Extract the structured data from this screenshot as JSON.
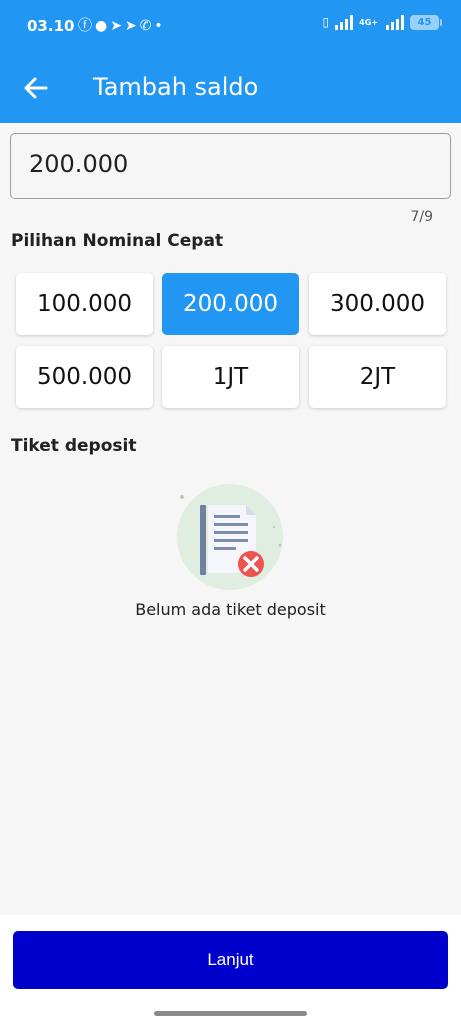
{
  "status_bar": {
    "time": "03.10",
    "notification_icons": [
      "facebook-icon",
      "chat-bubble-icon",
      "telegram-icon",
      "telegram-icon",
      "whatsapp-icon",
      "dot-icon"
    ],
    "network_label": "4G+",
    "battery": "45"
  },
  "header": {
    "title": "Tambah saldo",
    "back_icon": "arrow-left-icon"
  },
  "amount_input": {
    "value": "200.000",
    "char_count": "7/9"
  },
  "quick_nominal": {
    "title": "Pilihan Nominal Cepat",
    "options": [
      "100.000",
      "200.000",
      "300.000",
      "500.000",
      "1JT",
      "2JT"
    ],
    "selected": "200.000"
  },
  "deposit_tickets": {
    "title": "Tiket deposit",
    "empty_text": "Belum ada tiket deposit",
    "empty_icon": "document-error-icon"
  },
  "footer": {
    "next_label": "Lanjut"
  },
  "colors": {
    "primary": "#2196f3",
    "button": "#0000cc",
    "error": "#ef5350",
    "illustration_bg": "#dfeee0"
  }
}
